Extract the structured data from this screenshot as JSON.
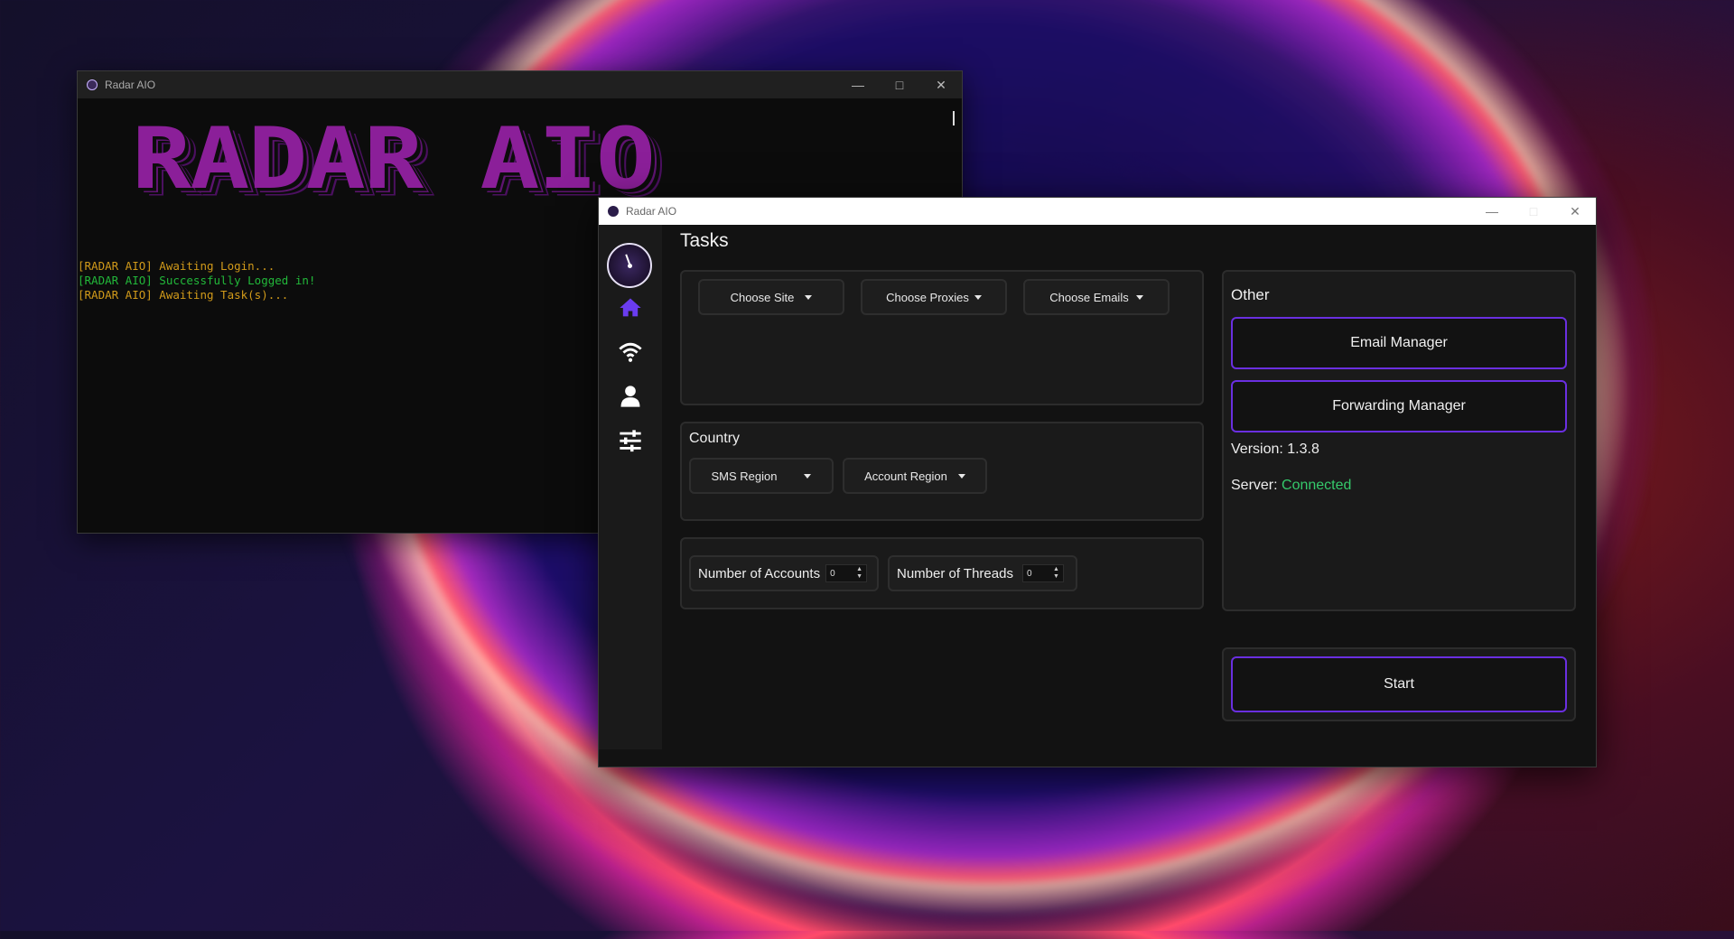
{
  "console": {
    "title": "Radar AIO",
    "banner": "RADAR AIO",
    "log": [
      "[RADAR AIO] Awaiting Login...",
      "[RADAR AIO] Successfully Logged in!",
      "[RADAR AIO] Awaiting Task(s)..."
    ],
    "colors": {
      "warn": "#d19a1a",
      "success": "#22b83a",
      "banner": "#8b1f99"
    }
  },
  "app": {
    "title": "Radar AIO",
    "page_title": "Tasks",
    "sidebar": {
      "items": [
        {
          "icon": "home-icon"
        },
        {
          "icon": "wifi-icon"
        },
        {
          "icon": "user-icon"
        },
        {
          "icon": "sliders-icon"
        }
      ]
    },
    "selectors": {
      "site": "Choose Site",
      "proxies": "Choose Proxies",
      "emails": "Choose Emails"
    },
    "country": {
      "label": "Country",
      "sms_region": "SMS Region",
      "account_region": "Account Region"
    },
    "numbers": {
      "accounts_label": "Number of Accounts",
      "accounts_value": "0",
      "threads_label": "Number of Threads",
      "threads_value": "0"
    },
    "other": {
      "label": "Other",
      "email_manager": "Email Manager",
      "forwarding_manager": "Forwarding Manager",
      "version": "Version: 1.3.8",
      "server_label": "Server:",
      "server_status": "Connected"
    },
    "start_label": "Start",
    "colors": {
      "accent": "#6a2fe0",
      "active_icon": "#6a3cf0",
      "connected": "#35c96b"
    }
  }
}
